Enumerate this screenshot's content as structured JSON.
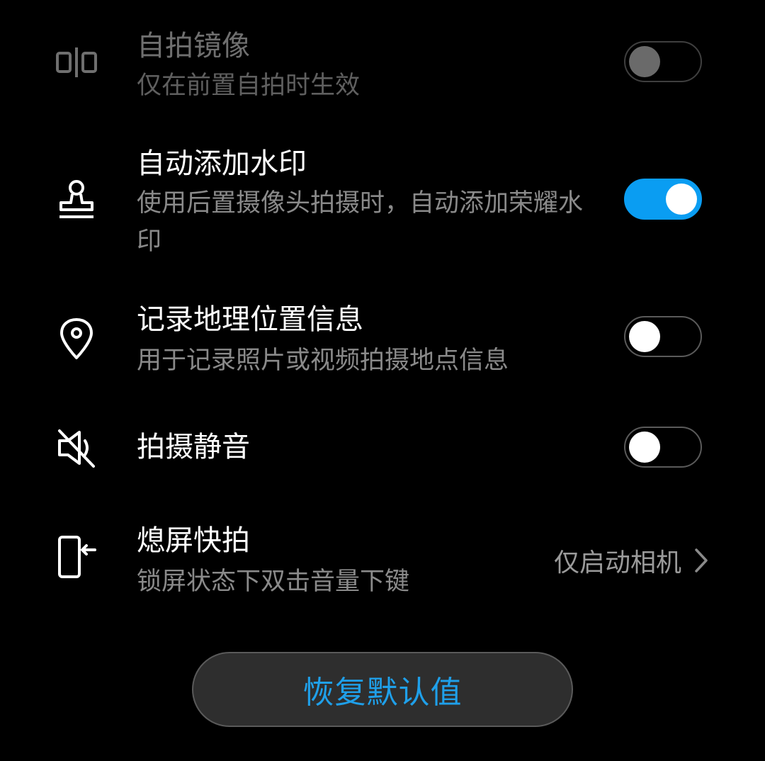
{
  "settings": [
    {
      "title": "自拍镜像",
      "subtitle": "仅在前置自拍时生效",
      "icon": "mirror-icon",
      "control": "switch",
      "on": false,
      "enabled": false
    },
    {
      "title": "自动添加水印",
      "subtitle": "使用后置摄像头拍摄时，自动添加荣耀水印",
      "icon": "stamp-icon",
      "control": "switch",
      "on": true,
      "enabled": true
    },
    {
      "title": "记录地理位置信息",
      "subtitle": "用于记录照片或视频拍摄地点信息",
      "icon": "location-pin-icon",
      "control": "switch",
      "on": false,
      "enabled": true
    },
    {
      "title": "拍摄静音",
      "icon": "mute-speaker-icon",
      "control": "switch",
      "on": false,
      "enabled": true
    },
    {
      "title": "熄屏快拍",
      "subtitle": "锁屏状态下双击音量下键",
      "icon": "phone-side-key-icon",
      "control": "link",
      "value": "仅启动相机"
    }
  ],
  "reset": {
    "label": "恢复默认值"
  },
  "colors": {
    "accent": "#0a9df2",
    "button_text": "#1fa0ea",
    "background": "#000000"
  }
}
